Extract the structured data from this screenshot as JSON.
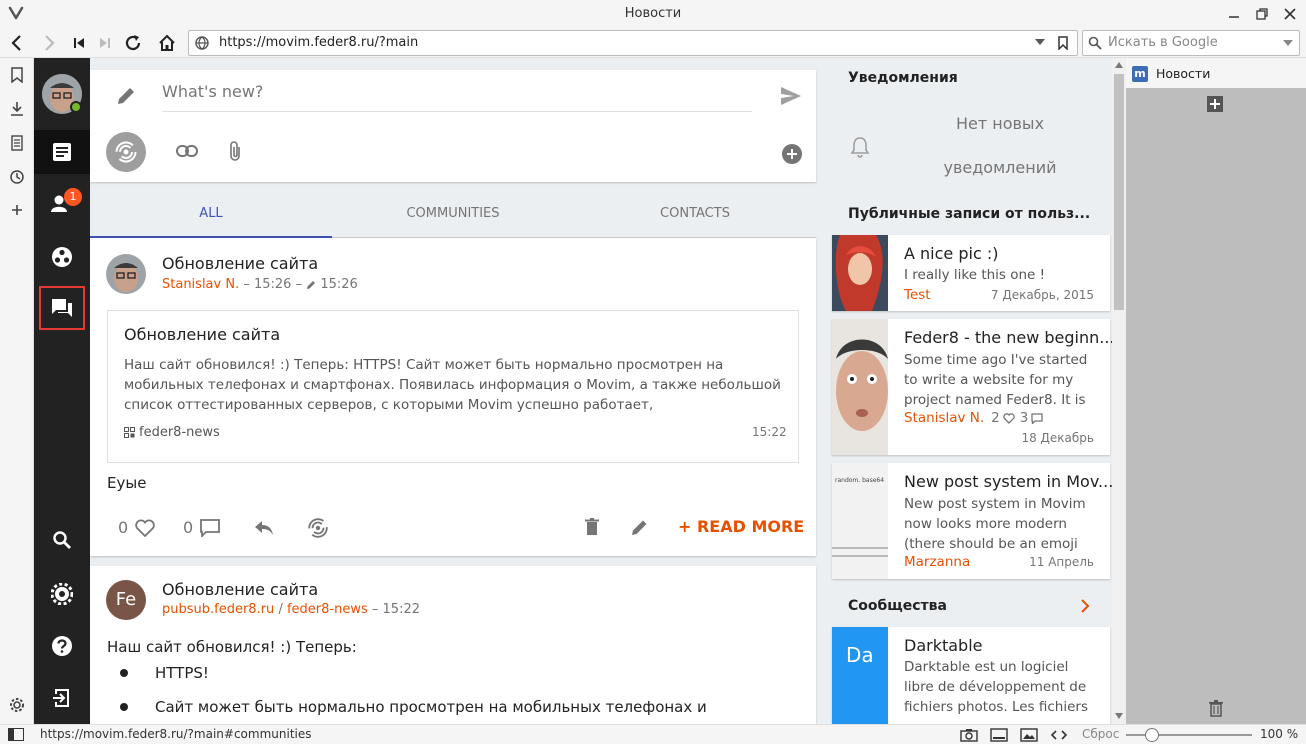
{
  "browser": {
    "window_title": "Новости",
    "url": "https://movim.feder8.ru/?main",
    "search_placeholder": "Искать в Google",
    "status_url": "https://movim.feder8.ru/?main#communities",
    "reset_label": "Сброс",
    "zoom": "100 %",
    "web_panel_title": "Новости"
  },
  "sidebar": {
    "contacts_badge": "1"
  },
  "composer": {
    "placeholder": "What's new?"
  },
  "tabs": [
    {
      "label": "ALL",
      "active": true
    },
    {
      "label": "COMMUNITIES",
      "active": false
    },
    {
      "label": "CONTACTS",
      "active": false
    }
  ],
  "post1": {
    "title": "Обновление сайта",
    "author": "Stanislav N.",
    "meta_time": "– 15:26 –",
    "edit_time": "15:26",
    "quote_title": "Обновление сайта",
    "quote_text": "Наш сайт обновился! :) Теперь: HTTPS! Сайт может быть нормально просмотрен на мобильных телефонах и смартфонах. Появилась информация о Movim, а также небольшой список оттестированных серверов, с которыми Movim успешно работает,",
    "quote_source": "feder8-news",
    "quote_time": "15:22",
    "comment": "Еуые",
    "likes": "0",
    "comments": "0",
    "read_more": "+ READ MORE"
  },
  "post2": {
    "avatar_text": "Fe",
    "title": "Обновление сайта",
    "server": "pubsub.feder8.ru",
    "separator": "/",
    "node": "feder8-news",
    "time": "– 15:22",
    "body": "Наш сайт обновился! :) Теперь:",
    "list": [
      "HTTPS!",
      "Сайт может быть нормально просмотрен на мобильных телефонах и"
    ]
  },
  "notifications": {
    "heading": "Уведомления",
    "empty_line1": "Нет новых",
    "empty_line2": "уведомлений"
  },
  "public_posts": {
    "heading": "Публичные записи от польз...",
    "items": [
      {
        "title": "A nice pic :)",
        "excerpt": "I really like this one !",
        "author": "Test",
        "date": "7 Декабрь, 2015"
      },
      {
        "title": "Feder8 - the new beginn...",
        "excerpt": "Some time ago I've started to write a website for my project named Feder8. It is",
        "author": "Stanislav N.",
        "likes": "2",
        "comments": "3",
        "date": "18 Декабрь"
      },
      {
        "title": "New post system in Mov...",
        "excerpt": "New post system in Movim now looks more modern (there should be an emoji but",
        "author": "Marzanna",
        "date": "11 Апрель",
        "thumb_text": "random. base64"
      }
    ]
  },
  "communities": {
    "heading": "Сообщества",
    "items": [
      {
        "avatar": "Da",
        "title": "Darktable",
        "excerpt": "Darktable est un logiciel libre de développement de fichiers photos. Les fichiers"
      }
    ]
  }
}
